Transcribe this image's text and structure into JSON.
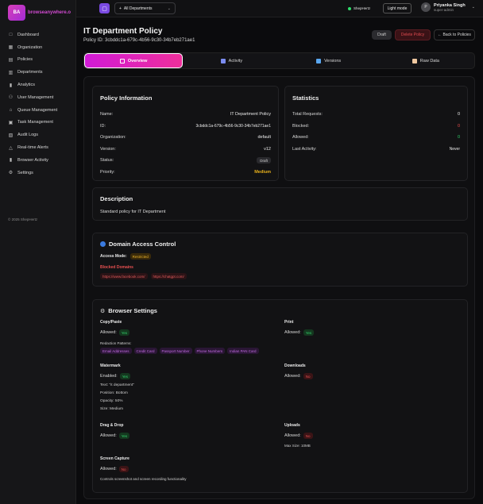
{
  "brand": {
    "initials": "BA",
    "name": "browseanywhere.o"
  },
  "sidebar": {
    "items": [
      {
        "label": "Dashboard",
        "icon": "□"
      },
      {
        "label": "Organization",
        "icon": "▦"
      },
      {
        "label": "Policies",
        "icon": "▤"
      },
      {
        "label": "Departments",
        "icon": "▥"
      },
      {
        "label": "Analytics",
        "icon": "▮"
      },
      {
        "label": "User Management",
        "icon": "⚇"
      },
      {
        "label": "Queue Management",
        "icon": "⌂"
      },
      {
        "label": "Task Management",
        "icon": "▣"
      },
      {
        "label": "Audit Logs",
        "icon": "▧"
      },
      {
        "label": "Real-time Alerts",
        "icon": "△"
      },
      {
        "label": "Browser Activity",
        "icon": "▮"
      },
      {
        "label": "Settings",
        "icon": "⚙"
      }
    ],
    "copyright": "© 2025 ShepHertz"
  },
  "topbar": {
    "department_select": "All Departments",
    "status_label": "ShepHertz",
    "light_mode_label": "Light mode",
    "user_initial": "P",
    "user_name": "Priyanka Singh",
    "user_role": "super-admin"
  },
  "header": {
    "title": "IT Department Policy",
    "policy_id": "Policy ID: 3cbddc1a-679c-4b56-9c30-34b7eb271ae1",
    "status_badge": "Draft",
    "delete_label": "Delete Policy",
    "back_label": "← Back to Policies"
  },
  "tabs": [
    {
      "label": "Overview",
      "icon_color": "#ffffff"
    },
    {
      "label": "Activity",
      "icon_color": "#7b8cf0"
    },
    {
      "label": "Versions",
      "icon_color": "#5aa7f0"
    },
    {
      "label": "Raw Data",
      "icon_color": "#f0c8a0"
    }
  ],
  "policy_info": {
    "title": "Policy Information",
    "rows": [
      {
        "label": "Name:",
        "value": "IT Department Policy"
      },
      {
        "label": "ID:",
        "value": "3cbddc1a-679c-4b56-9c30-34b7eb271ae1"
      },
      {
        "label": "Organization:",
        "value": "default"
      },
      {
        "label": "Version:",
        "value": "v12"
      }
    ],
    "status_label": "Status:",
    "status_value": "Draft",
    "priority_label": "Priority:",
    "priority_value": "Medium"
  },
  "statistics": {
    "title": "Statistics",
    "rows": [
      {
        "label": "Total Requests:",
        "value": "0"
      },
      {
        "label": "Blocked:",
        "value": "0"
      },
      {
        "label": "Allowed:",
        "value": "0"
      },
      {
        "label": "Last Activity:",
        "value": "Never"
      }
    ]
  },
  "description": {
    "title": "Description",
    "text": "Standard policy for IT Department"
  },
  "domain_access": {
    "title": "Domain Access Control",
    "mode_label": "Access Mode:",
    "mode_value": "Restricted",
    "blocked_title": "Blocked Domains",
    "blocked": [
      "https://www.facebook.com/",
      "https://chatgpt.com/"
    ]
  },
  "browser_settings": {
    "title": "Browser Settings",
    "copy_paste": {
      "title": "Copy/Paste",
      "allowed_label": "Allowed:",
      "allowed": "Yes",
      "patterns_label": "Redaction Patterns:",
      "patterns": [
        "Email Addresses",
        "Credit Card",
        "Passport Number",
        "Phone Numbers",
        "Indian PAN Card"
      ]
    },
    "print": {
      "title": "Print",
      "allowed_label": "Allowed:",
      "allowed": "Yes"
    },
    "watermark": {
      "title": "Watermark",
      "enabled_label": "Enabled:",
      "enabled": "Yes",
      "text": "Text: \"it department\"",
      "position": "Position: Bottom",
      "opacity": "Opacity: 50%",
      "size": "Size: Medium"
    },
    "downloads": {
      "title": "Downloads",
      "allowed_label": "Allowed:",
      "allowed": "No"
    },
    "drag_drop": {
      "title": "Drag & Drop",
      "allowed_label": "Allowed:",
      "allowed": "Yes"
    },
    "uploads": {
      "title": "Uploads",
      "allowed_label": "Allowed:",
      "allowed": "No",
      "max_size": "Max Size: 10MB"
    },
    "screen_capture": {
      "title": "Screen Capture",
      "allowed_label": "Allowed:",
      "allowed": "No",
      "note": "Controls screenshot and screen recording functionality"
    }
  }
}
